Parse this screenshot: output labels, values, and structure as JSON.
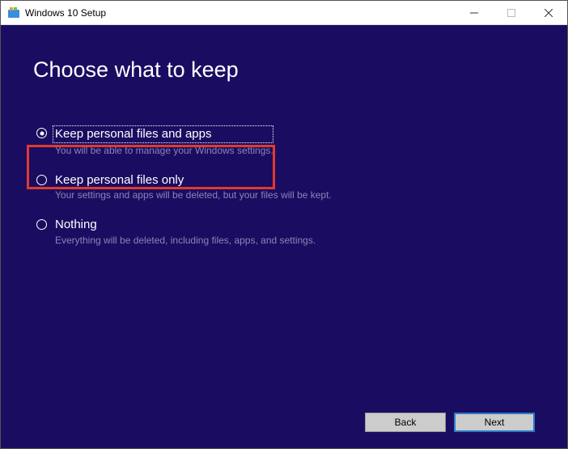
{
  "window": {
    "title": "Windows 10 Setup"
  },
  "heading": "Choose what to keep",
  "options": [
    {
      "label": "Keep personal files and apps",
      "desc": "You will be able to manage your Windows settings.",
      "selected": true
    },
    {
      "label": "Keep personal files only",
      "desc": "Your settings and apps will be deleted, but your files will be kept.",
      "selected": false
    },
    {
      "label": "Nothing",
      "desc": "Everything will be deleted, including files, apps, and settings.",
      "selected": false
    }
  ],
  "buttons": {
    "back": "Back",
    "next": "Next"
  }
}
